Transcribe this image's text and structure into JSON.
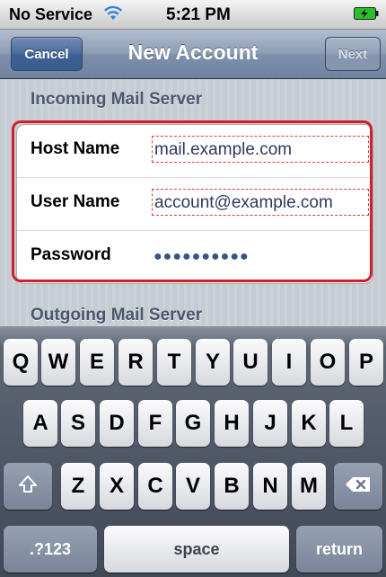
{
  "status_bar": {
    "carrier": "No Service",
    "time": "5:21 PM",
    "wifi_icon": "wifi-icon",
    "battery_icon": "battery-charging-icon"
  },
  "nav": {
    "cancel_label": "Cancel",
    "title": "New Account",
    "next_label": "Next"
  },
  "incoming": {
    "header": "Incoming Mail Server",
    "host_label": "Host Name",
    "host_value": "mail.example.com",
    "user_label": "User Name",
    "user_value": "account@example.com",
    "password_label": "Password",
    "password_value": "●●●●●●●●●●"
  },
  "outgoing": {
    "header": "Outgoing Mail Server"
  },
  "keyboard": {
    "row1": [
      "Q",
      "W",
      "E",
      "R",
      "T",
      "Y",
      "U",
      "I",
      "O",
      "P"
    ],
    "row2": [
      "A",
      "S",
      "D",
      "F",
      "G",
      "H",
      "J",
      "K",
      "L"
    ],
    "row3": [
      "Z",
      "X",
      "C",
      "V",
      "B",
      "N",
      "M"
    ],
    "shift_icon": "shift-icon",
    "delete_icon": "backspace-icon",
    "numbers_label": ".?123",
    "space_label": "space",
    "return_label": "return"
  },
  "colors": {
    "highlight": "#d21f2a",
    "nav_accent": "#4a6b9d"
  }
}
